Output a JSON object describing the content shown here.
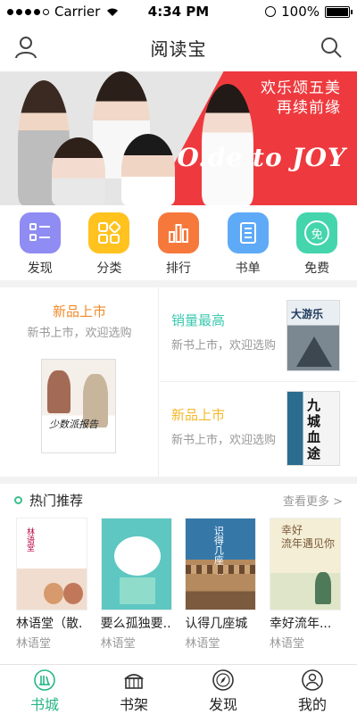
{
  "status": {
    "carrier": "Carrier",
    "time": "4:34 PM",
    "battery": "100%"
  },
  "nav": {
    "title": "阅读宝"
  },
  "banner": {
    "slogan_line1": "欢乐颂五美",
    "slogan_line2": "再续前缘",
    "logo_text": "O.de to JOY"
  },
  "categories": [
    {
      "label": "发现",
      "color": "#8f8cf3",
      "icon": "list-icon"
    },
    {
      "label": "分类",
      "color": "#ffc21f",
      "icon": "grid-icon"
    },
    {
      "label": "排行",
      "color": "#f6793b",
      "icon": "bar-chart-icon"
    },
    {
      "label": "书单",
      "color": "#5eaaf6",
      "icon": "notebook-icon"
    },
    {
      "label": "免费",
      "color": "#44d5ad",
      "icon": "free-icon",
      "glyph": "免"
    }
  ],
  "promo": {
    "left": {
      "title": "新品上市",
      "subtitle": "新书上市，欢迎选购",
      "cover_text": "少数派报告"
    },
    "right_top": {
      "title": "销量最高",
      "subtitle": "新书上市，欢迎选购",
      "title_color": "#3cc9b0",
      "cover_text": "大游乐"
    },
    "right_bottom": {
      "title": "新品上市",
      "subtitle": "新书上市，欢迎选购",
      "title_color": "#f5b82d",
      "cover_text": "九城血途"
    }
  },
  "hot": {
    "title": "热门推荐",
    "more": "查看更多 >",
    "books": [
      {
        "name": "林语堂（散.",
        "author": "林语堂"
      },
      {
        "name": "要么孤独要..",
        "author": "林语堂"
      },
      {
        "name": "认得几座城",
        "author": "林语堂"
      },
      {
        "name": "幸好流年...",
        "author": "林语堂"
      }
    ]
  },
  "tabs": [
    {
      "label": "书城",
      "icon": "bookstore-icon",
      "active": true
    },
    {
      "label": "书架",
      "icon": "bookshelf-icon",
      "active": false
    },
    {
      "label": "发现",
      "icon": "compass-icon",
      "active": false
    },
    {
      "label": "我的",
      "icon": "profile-icon",
      "active": false
    }
  ],
  "colors": {
    "accent": "#26b585",
    "banner_red": "#ee3a3e"
  }
}
